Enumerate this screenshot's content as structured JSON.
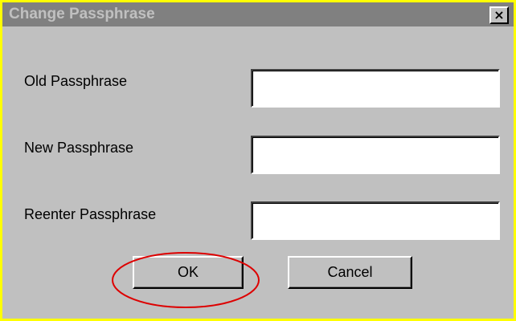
{
  "dialog": {
    "title": "Change Passphrase",
    "close_glyph": "×",
    "close_icon": "close-icon"
  },
  "fields": [
    {
      "label": "Old Passphrase",
      "value": ""
    },
    {
      "label": "New Passphrase",
      "value": ""
    },
    {
      "label": "Reenter Passphrase",
      "value": ""
    }
  ],
  "buttons": {
    "ok_label": "OK",
    "cancel_label": "Cancel"
  },
  "annotation": {
    "highlight_color": "#dd0000",
    "highlighted_element": "ok-button"
  },
  "colors": {
    "frame": "#ffff00",
    "dialog_face": "#c0c0c0",
    "titlebar_inactive": "#808080",
    "field_background": "#ffffff"
  }
}
